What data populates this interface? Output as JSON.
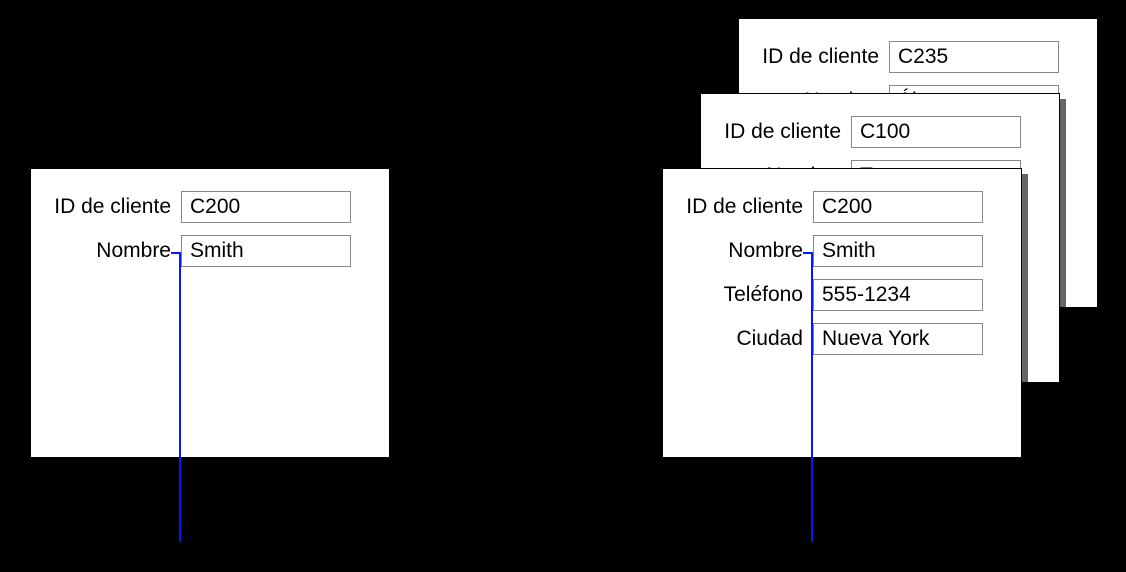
{
  "labels": {
    "client_id": "ID de cliente",
    "name": "Nombre",
    "phone": "Teléfono",
    "city": "Ciudad"
  },
  "left_card": {
    "client_id": "C200",
    "name": "Smith"
  },
  "right_cards": {
    "back": {
      "client_id": "C235",
      "name": "Álvarez"
    },
    "middle": {
      "client_id": "C100",
      "name": "Tang"
    },
    "front": {
      "client_id": "C200",
      "name": "Smith",
      "phone": "555-1234",
      "city": "Nueva York"
    }
  }
}
